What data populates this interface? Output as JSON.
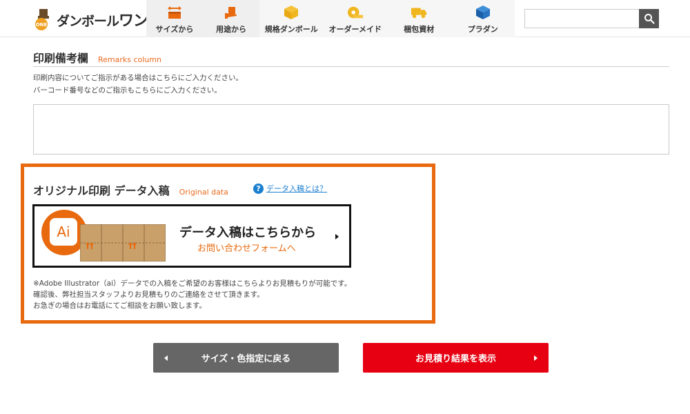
{
  "header": {
    "logo_text_prefix": "ダンボール",
    "logo_text_suffix": "ワン",
    "logo_badge": "ONE",
    "nav_primary": [
      {
        "label": "サイズから",
        "icon": "size-arrows-icon"
      },
      {
        "label": "用途から",
        "icon": "usage-hand-icon"
      }
    ],
    "nav_secondary": [
      {
        "label": "規格ダンボール",
        "icon": "standard-box-icon"
      },
      {
        "label": "オーダーメイド",
        "icon": "tape-measure-icon"
      },
      {
        "label": "梱包資材",
        "icon": "truck-icon"
      },
      {
        "label": "プラダン",
        "icon": "cube-icon"
      }
    ],
    "search": {
      "value": "",
      "placeholder": ""
    }
  },
  "remarks": {
    "title": "印刷備考欄",
    "title_en": "Remarks column",
    "note_line1": "印刷内容についてご指示がある場合はこちらにご入力ください。",
    "note_line2": "バーコード番号などのご指示もこちらにご入力ください。",
    "textarea_value": ""
  },
  "original_data": {
    "title": "オリジナル印刷 データ入稿",
    "title_en": "Original data",
    "help_icon_text": "?",
    "help_link": "データ入稿とは？",
    "banner_ai": "Ai",
    "banner_main": "データ入稿はこちらから",
    "banner_sub": "お問い合わせフォームへ",
    "note_line1": "※Adobe Illustrator（ai）データでの入稿をご希望のお客様はこちらよりお見積もりが可能です。",
    "note_line2": "確認後、弊社担当スタッフよりお見積もりのご連絡をさせて頂きます。",
    "note_line3": "お急ぎの場合はお電話にてご相談をお願い致します。"
  },
  "buttons": {
    "back_label": "サイズ・色指定に戻る",
    "result_label": "お見積り結果を表示"
  },
  "colors": {
    "accent_orange": "#e8690e",
    "result_red": "#e60012",
    "back_gray": "#666666",
    "link_blue": "#1a7fd0"
  }
}
